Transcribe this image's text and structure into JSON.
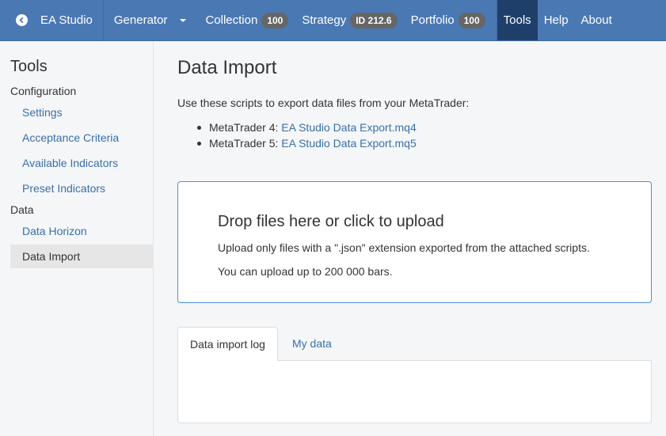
{
  "navbar": {
    "brand": "EA Studio",
    "generator": "Generator",
    "collection": {
      "label": "Collection",
      "badge": "100"
    },
    "strategy": {
      "label": "Strategy",
      "badge": "ID 212.6"
    },
    "portfolio": {
      "label": "Portfolio",
      "badge": "100"
    },
    "tools": "Tools",
    "help": "Help",
    "about": "About",
    "colors": {
      "bar": "#4a78b3",
      "active": "#1f3f6b",
      "badge": "#666666"
    }
  },
  "sidebar": {
    "title": "Tools",
    "group_configuration": "Configuration",
    "settings": "Settings",
    "acceptance_criteria": "Acceptance Criteria",
    "available_indicators": "Available Indicators",
    "preset_indicators": "Preset Indicators",
    "group_data": "Data",
    "data_horizon": "Data Horizon",
    "data_import": "Data Import"
  },
  "main": {
    "title": "Data Import",
    "intro": "Use these scripts to export data files from your MetaTrader:",
    "scripts": [
      {
        "prefix": "MetaTrader 4: ",
        "link": "EA Studio Data Export.mq4"
      },
      {
        "prefix": "MetaTrader 5: ",
        "link": "EA Studio Data Export.mq5"
      }
    ],
    "dropzone": {
      "title": "Drop files here or click to upload",
      "line1": "Upload only files with a \".json\" extension exported from the attached scripts.",
      "line2": "You can upload up to 200 000 bars."
    },
    "tabs": {
      "log": "Data import log",
      "my_data": "My data"
    }
  }
}
